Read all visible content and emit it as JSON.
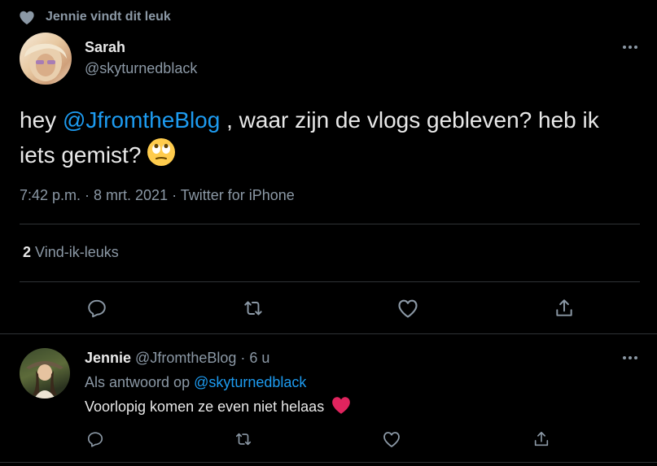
{
  "social_context": {
    "text": "Jennie vindt dit leuk"
  },
  "tweet": {
    "author_name": "Sarah",
    "author_handle": "@skyturnedblack",
    "text_before": "hey ",
    "mention": "@JfromtheBlog",
    "text_after": " , waar zijn de vlogs gebleven? heb ik iets gemist?",
    "timestamp": "7:42 p.m. · 8 mrt. 2021 · Twitter for iPhone",
    "likes_count": "2",
    "likes_label": "Vind-ik-leuks"
  },
  "reply": {
    "author_name": "Jennie",
    "author_handle": "@JfromtheBlog · 6 u",
    "replying_to_label": "Als antwoord op",
    "replying_to_handle": "@skyturnedblack",
    "text": "Voorlopig komen ze even niet helaas"
  },
  "icons": {
    "social": "heart-icon",
    "more": "more-dots-icon",
    "reply": "reply-icon",
    "retweet": "retweet-icon",
    "like": "like-icon",
    "share": "share-icon",
    "emoji": "face-with-rolling-eyes-emoji",
    "heart": "red-heart-emoji"
  },
  "colors": {
    "background": "#000000",
    "link": "#1d9bf0",
    "muted": "#8b98a5",
    "heart": "#e0245e"
  }
}
